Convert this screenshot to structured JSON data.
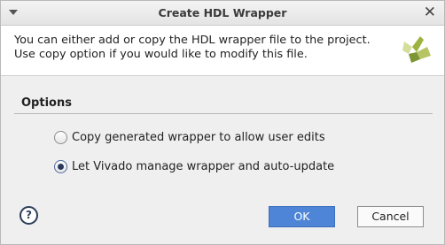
{
  "window": {
    "title": "Create HDL Wrapper"
  },
  "header": {
    "description": "You can either add or copy the HDL wrapper file to the project. Use copy option if you would like to modify this file."
  },
  "options": {
    "label": "Options",
    "items": [
      {
        "label": "Copy generated wrapper to allow user edits",
        "selected": false
      },
      {
        "label": "Let Vivado manage wrapper and auto-update",
        "selected": true
      }
    ]
  },
  "footer": {
    "help_symbol": "?",
    "ok_label": "OK",
    "cancel_label": "Cancel"
  },
  "colors": {
    "ok_button": "#4f85d6",
    "logo_green": "#8fa83a"
  }
}
